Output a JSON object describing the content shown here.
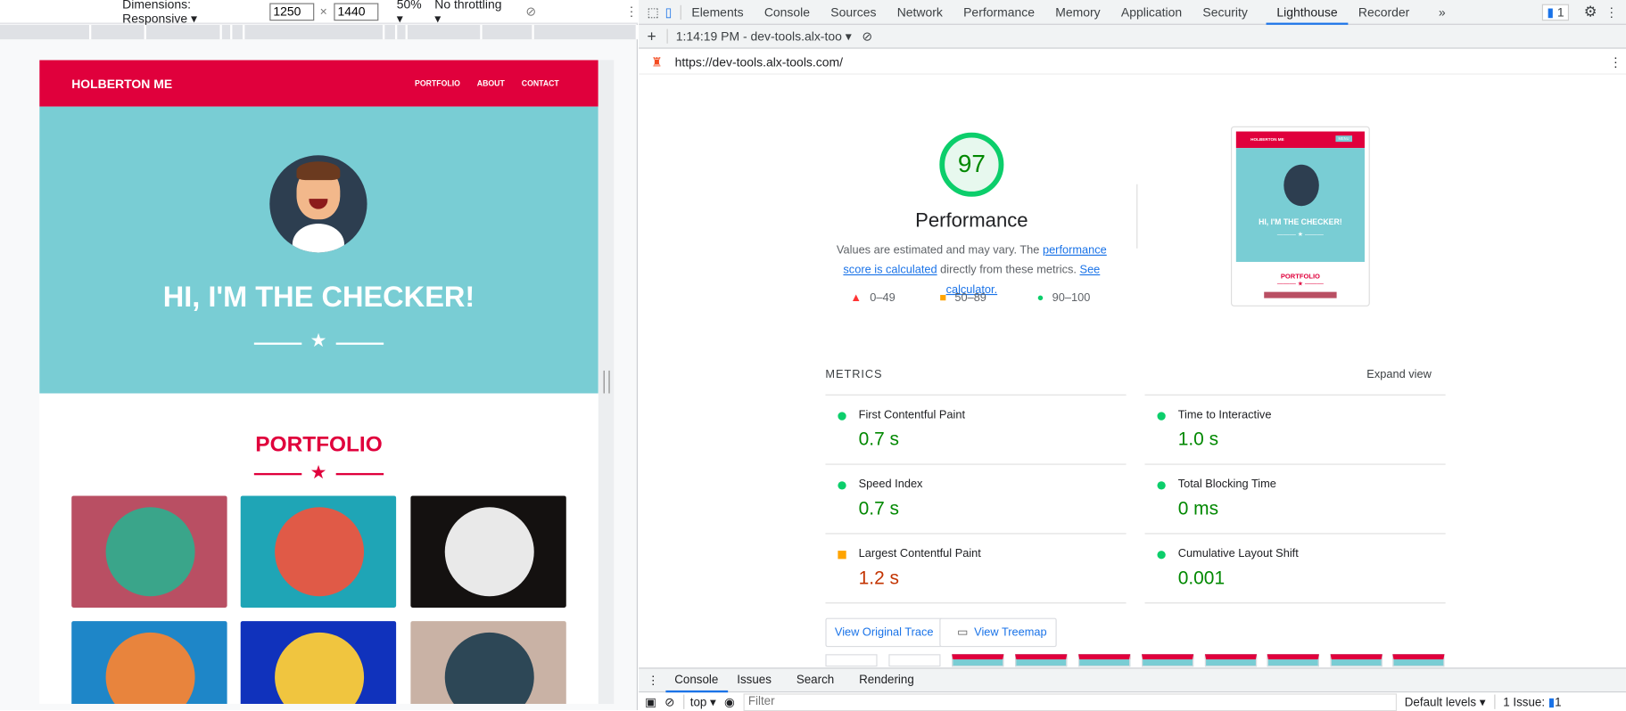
{
  "device_toolbar": {
    "dimensions": "Dimensions: Responsive",
    "width": "1250",
    "height": "1440",
    "times": "×",
    "zoom": "50%",
    "throttling": "No throttling"
  },
  "site": {
    "brand": "HOLBERTON ME",
    "nav": [
      "PORTFOLIO",
      "ABOUT",
      "CONTACT"
    ],
    "hero_title": "HI, I'M THE CHECKER!",
    "portfolio_title": "PORTFOLIO",
    "tile_colors": [
      "#b94f63",
      "#1fa5b6",
      "#141110",
      "#1e86c8",
      "#1032bc",
      "#c9b2a5"
    ]
  },
  "devtools": {
    "tabs": [
      "Elements",
      "Console",
      "Sources",
      "Network",
      "Performance",
      "Memory",
      "Application",
      "Security",
      "Lighthouse",
      "Recorder",
      "»"
    ],
    "active_tab": "Lighthouse",
    "issues_badge": "1",
    "report_select": "1:14:19 PM - dev-tools.alx-too",
    "url": "https://dev-tools.alx-tools.com/"
  },
  "report": {
    "score": "97",
    "category": "Performance",
    "desc_pre": "Values are estimated and may vary. The ",
    "link1": "performance score is calculated",
    "desc_mid": " directly from these metrics. ",
    "link2": "See calculator.",
    "legend": [
      "0–49",
      "50–89",
      "90–100"
    ],
    "thumb": {
      "brand": "HOLBERTON ME",
      "menu": "MENU",
      "title": "HI, I'M THE CHECKER!",
      "portfolio": "PORTFOLIO"
    },
    "metrics_title": "METRICS",
    "expand": "Expand view",
    "metrics": [
      {
        "name": "First Contentful Paint",
        "value": "0.7 s",
        "status": "pass"
      },
      {
        "name": "Time to Interactive",
        "value": "1.0 s",
        "status": "pass"
      },
      {
        "name": "Speed Index",
        "value": "0.7 s",
        "status": "pass"
      },
      {
        "name": "Total Blocking Time",
        "value": "0 ms",
        "status": "pass"
      },
      {
        "name": "Largest Contentful Paint",
        "value": "1.2 s",
        "status": "average"
      },
      {
        "name": "Cumulative Layout Shift",
        "value": "0.001",
        "status": "pass"
      }
    ],
    "buttons": [
      "View Original Trace",
      "View Treemap"
    ]
  },
  "drawer": {
    "tabs": [
      "Console",
      "Issues",
      "Search",
      "Rendering"
    ],
    "context": "top",
    "filter_placeholder": "Filter",
    "levels": "Default levels",
    "issues": "1 Issue:",
    "issues_count": "1"
  }
}
